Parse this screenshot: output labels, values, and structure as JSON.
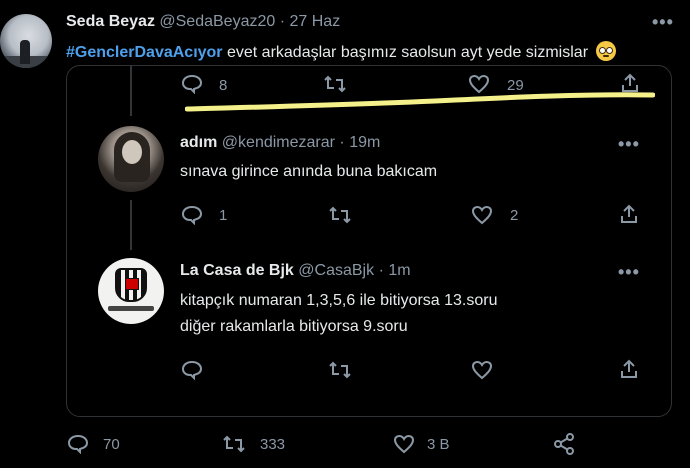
{
  "main_tweet": {
    "display_name": "Seda Beyaz",
    "handle": "@SedaBeyaz20",
    "separator": "·",
    "date": "27 Haz",
    "more": "•••",
    "hashtag": "#GenclerDavaAcıyor",
    "text": " evet arkadaşlar başımız saolsun ayt yede sizmislar",
    "emoji": "face-with-rolling-eyes",
    "actions": {
      "reply_count": "70",
      "retweet_count": "333",
      "like_count": "3 B"
    }
  },
  "quoted": {
    "partial_row": {
      "reply_count": "8",
      "like_count": "29"
    },
    "replies": [
      {
        "display_name": "adım",
        "handle": "@kendimezarar",
        "separator": "·",
        "time": "19m",
        "more": "•••",
        "text": "sınava girince anında buna bakıcam",
        "reply_count": "1",
        "like_count": "2"
      },
      {
        "display_name": "La Casa de Bjk",
        "handle": "@CasaBjk",
        "separator": "·",
        "time": "1m",
        "more": "•••",
        "text_line1": "kitapçık numaran 1,3,5,6 ile bitiyorsa 13.soru",
        "text_line2": "diğer rakamlarla bitiyorsa 9.soru"
      }
    ]
  },
  "colors": {
    "background": "#000000",
    "text": "#e7e9ea",
    "muted": "#8b98a5",
    "hashtag": "#4ea0ec",
    "highlight_marker": "#f4f08a"
  }
}
